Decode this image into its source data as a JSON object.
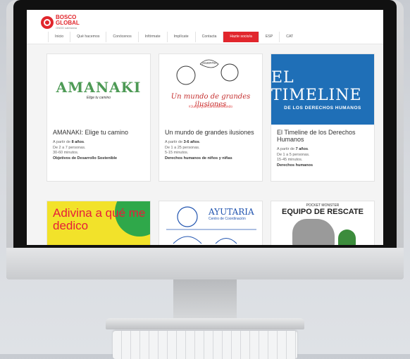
{
  "logo": {
    "line1": "BOSCO",
    "line2": "GLOBAL",
    "tagline": "ONGD salesiana"
  },
  "nav": {
    "items": [
      {
        "label": "Inicio",
        "active": false
      },
      {
        "label": "Qué hacemos",
        "active": false
      },
      {
        "label": "Conócenos",
        "active": false
      },
      {
        "label": "Infórmate",
        "active": false
      },
      {
        "label": "Implícate",
        "active": false
      },
      {
        "label": "Contacta",
        "active": false
      },
      {
        "label": "Hazte socio/a",
        "active": true
      },
      {
        "label": "ESP",
        "active": false
      },
      {
        "label": "CAT",
        "active": false
      }
    ]
  },
  "cards": [
    {
      "image": {
        "title": "AMANAKI",
        "subtitle": "Elige tu camino"
      },
      "title": "AMANAKI: Elige tu camino",
      "age_prefix": "A partir de ",
      "age": "8 años",
      "age_suffix": ".",
      "people": "De 2 a 7 personas.",
      "duration": "30-60 minutos.",
      "topic": "Objetivos de Desarrollo Sostenible"
    },
    {
      "image": {
        "speech": "¡SUERTE!",
        "title": "Un mundo de grandes ilusiones",
        "hashtag": "#JuegoQueCambiaelMundo"
      },
      "title": "Un mundo de grandes ilusiones",
      "age_prefix": "A partir de ",
      "age": "3-6 años",
      "age_suffix": ".",
      "people": "De 1 a 25 personas.",
      "duration": "5-15 minutos.",
      "topic": "Derechos humanos de niños y niñas"
    },
    {
      "image": {
        "title": "EL TIMELINE",
        "subtitle": "DE LOS DERECHOS HUMANOS"
      },
      "title": "El Timeline de los Derechos Humanos",
      "age_prefix": "A partir de ",
      "age": "7 años",
      "age_suffix": ".",
      "people": "De 1 a 5 personas.",
      "duration": "15-45 minutos.",
      "topic": "Derechos humanos"
    },
    {
      "image": {
        "title": "Adivina a qué me dedico"
      }
    },
    {
      "image": {
        "title": "AYUTARIA",
        "subtitle": "Centro de Coordinación"
      }
    },
    {
      "image": {
        "small": "POCKET MONSTER",
        "title": "EQUIPO DE RESCATE"
      }
    }
  ],
  "colors": {
    "accent": "#e1262c",
    "timeline_blue": "#1f6fb7",
    "amanaki_green": "#4d9a55"
  }
}
